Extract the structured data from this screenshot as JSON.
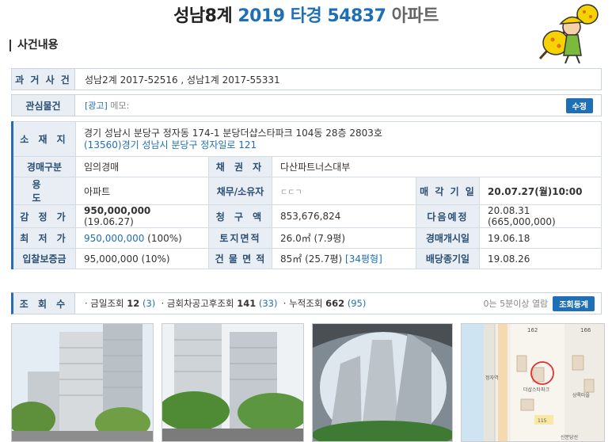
{
  "title": {
    "court": "성남8계",
    "case_no": "2019 타경 54837",
    "type": "아파트"
  },
  "section": "사건내용",
  "past_case": {
    "label": "과 거 사 건",
    "value": "성남2계 2017-52516 , 성남1계 2017-55331"
  },
  "interest": {
    "label": "관심물건",
    "ad": "[광고]",
    "memo": " 메모:",
    "edit_button": "수정"
  },
  "location": {
    "label": "소 재 지",
    "address": "경기 성남시 분당구 정자동 174-1 분당더샵스타파크 104동 28층 2803호",
    "road": "(13560)경기 성남시 분당구 정자일로 121"
  },
  "details": {
    "auction_type_label": "경매구분",
    "auction_type": "임의경매",
    "creditor_label": "채 권 자",
    "creditor": "다산파트너스대부",
    "use_label": "용 도",
    "use": "아파트",
    "debtor_label": "채무/소유자",
    "debtor": "ㄷㄷㄱ",
    "sale_date_label": "매 각 기 일",
    "sale_date": "20.07.27(월)10:00",
    "appraisal_label": "감 정 가",
    "appraisal": "950,000,000",
    "appraisal_date": " (19.06.27)",
    "claim_label": "청 구 액",
    "claim": "853,676,824",
    "next_label": "다음예정",
    "next": "20.08.31 (665,000,000)",
    "min_label": "최 저 가",
    "min": "950,000,000",
    "min_pct": " (100%)",
    "land_label": "토지면적",
    "land": "26.0㎡ (7.9평)",
    "start_label": "경매개시일",
    "start": "19.06.18",
    "deposit_label": "입찰보증금",
    "deposit": "95,000,000 (10%)",
    "building_label": "건 물 면 적",
    "building": "85㎡ (25.7평) ",
    "building_type": "[34평형]",
    "dividend_label": "배당종기일",
    "dividend": "19.08.26"
  },
  "views": {
    "label": "조 회 수",
    "today_label": "· 금일조회 ",
    "today": "12",
    "today_sub": " (3)",
    "since_label": "· 금회차공고후조회 ",
    "since": "141",
    "since_sub": " (33)",
    "total_label": "· 누적조회 ",
    "total": "662",
    "total_sub": " (95)",
    "note": "0는 5분이상 열람",
    "register_button": "조회등계"
  },
  "map_labels": {
    "a": "162",
    "b": "166",
    "c": "더샵스타파크",
    "d": "상록마을",
    "e": "정자역",
    "f": "115",
    "g": "신분당선"
  }
}
